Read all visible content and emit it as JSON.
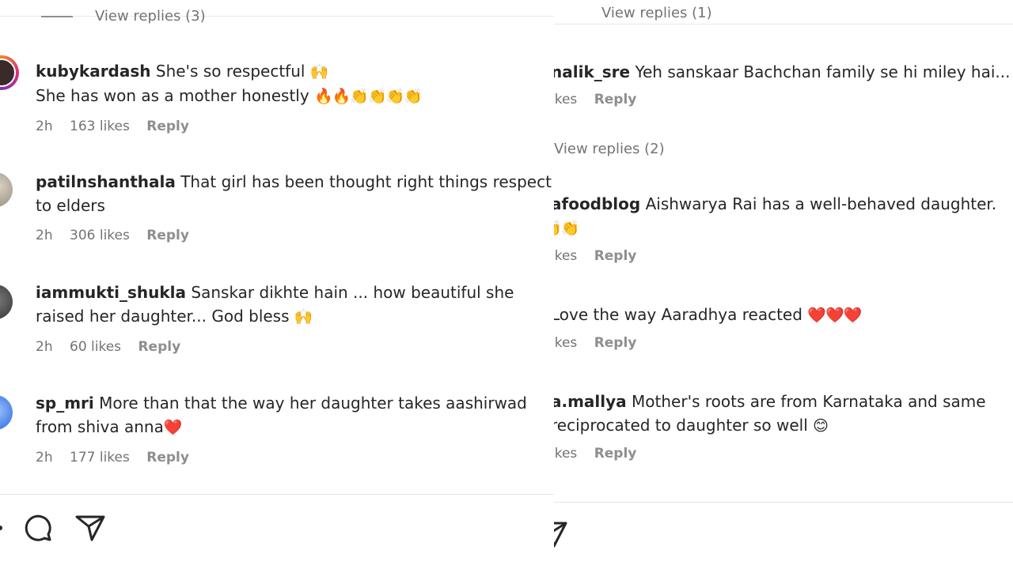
{
  "left": {
    "top_view_replies": "View replies (3)",
    "comments": [
      {
        "username": "kubykardash",
        "line1": "She's so respectful",
        "line1_emoji": "🙌",
        "line2": "She has won as a mother honestly",
        "line2_emoji": "🔥🔥👏👏👏👏",
        "time": "2h",
        "likes": "163 likes",
        "reply": "Reply"
      },
      {
        "username": "patilnshanthala",
        "line1": "That girl has been thought right things respect",
        "line2": "to elders",
        "time": "2h",
        "likes": "306 likes",
        "reply": "Reply"
      },
      {
        "username": "iammukti_shukla",
        "line1": "Sanskar dikhte hain ... how beautiful she",
        "line2": "raised her daughter... God bless",
        "line2_emoji": "🙌",
        "time": "2h",
        "likes": "60 likes",
        "reply": "Reply"
      },
      {
        "username": "sp_mri",
        "line1": "More than that the way her daughter takes aashirwad",
        "line2": "from shiva anna",
        "line2_emoji": "❤️",
        "time": "2h",
        "likes": "177 likes",
        "reply": "Reply"
      }
    ],
    "icons": [
      "comment-icon",
      "share-icon"
    ]
  },
  "right": {
    "top_text": "View replies (1)",
    "comments": [
      {
        "username": "nalik_sre",
        "line1": "Yeh sanskaar Bachchan family se hi miley hai...",
        "likes": "ikes",
        "reply": "Reply"
      },
      {
        "username": "afoodblog",
        "line1": "Aishwarya Rai has a well-behaved daughter.",
        "line2_emoji": "👏👏",
        "likes": "ikes",
        "reply": "Reply"
      },
      {
        "username": "",
        "line1": "Love the way Aaradhya reacted",
        "line1_emoji": "❤️❤️❤️",
        "likes": "ikes",
        "reply": "Reply"
      },
      {
        "username": "a.mallya",
        "line1": "Mother's roots are from Karnataka and same",
        "line2": "reciprocated to daughter so well",
        "line2_emoji": "😊",
        "likes": "ikes",
        "reply": "Reply"
      }
    ],
    "view_replies": "View replies (2)",
    "icons": [
      "share-icon"
    ]
  }
}
